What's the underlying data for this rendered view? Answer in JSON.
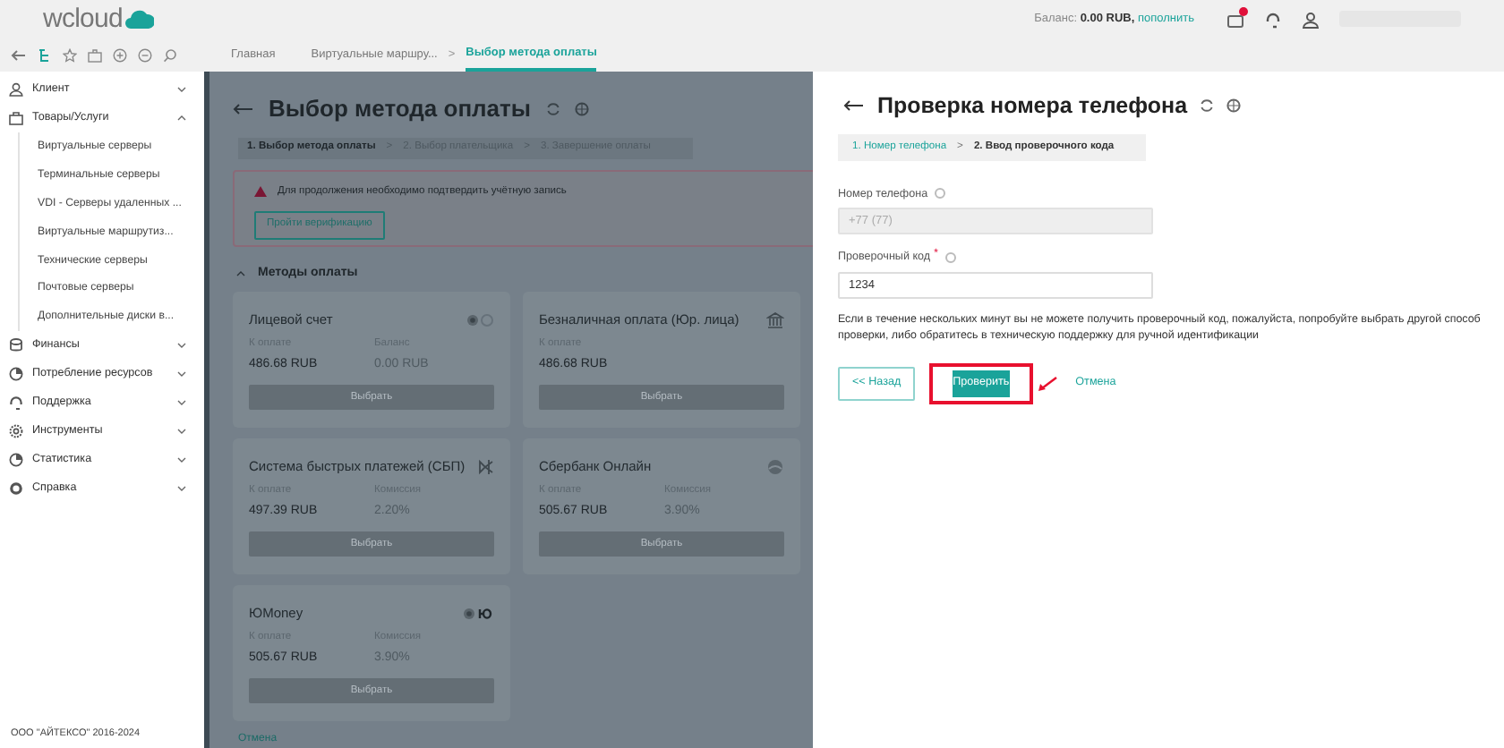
{
  "header": {
    "logo": "wcloud",
    "breadcrumbs": [
      {
        "label": "Главная",
        "selected": false
      },
      {
        "label": "Виртуальные маршру...",
        "selected": false
      },
      {
        "label": "Выбор метода оплаты",
        "selected": true,
        "separator": ">"
      }
    ],
    "balance_label": "Баланс:",
    "balance_amount": "0.00 RUB,",
    "balance_link": "пополнить",
    "notification": true
  },
  "sidebar": {
    "items": [
      {
        "label": "Клиент",
        "expanded": false
      },
      {
        "label": "Товары/Услуги",
        "expanded": true,
        "children": [
          "Виртуальные серверы",
          "Терминальные серверы",
          "VDI - Серверы удаленных ...",
          "Виртуальные маршрутиз...",
          "Технические серверы",
          "Почтовые серверы",
          "Дополнительные диски в..."
        ]
      },
      {
        "label": "Финансы",
        "expanded": false
      },
      {
        "label": "Потребление ресурсов",
        "expanded": false
      },
      {
        "label": "Поддержка",
        "expanded": false
      },
      {
        "label": "Инструменты",
        "expanded": false
      },
      {
        "label": "Статистика",
        "expanded": false
      },
      {
        "label": "Справка",
        "expanded": false
      }
    ],
    "footer": "ООО \"АЙТЕКСО\" 2016-2024"
  },
  "page": {
    "title": "Выбор метода оплаты",
    "steps": [
      {
        "label": "1. Выбор метода оплаты",
        "selected": true
      },
      {
        "label": "2. Выбор плательщика",
        "selected": false,
        "separator": ">"
      },
      {
        "label": "3. Завершение оплаты",
        "selected": false,
        "separator": ">"
      }
    ],
    "alert": {
      "text": "Для продолжения необходимо подтвердить учётную запись",
      "button": "Пройти верификацию"
    },
    "section": {
      "title": "Методы оплаты",
      "expanded": true
    },
    "methods": [
      {
        "name": "Лицевой счет",
        "fields": [
          {
            "label": "К оплате",
            "value": "486.68 RUB"
          },
          {
            "label": "Баланс",
            "value": "0.00 RUB"
          }
        ],
        "button": "Выбрать"
      },
      {
        "name": "Безналичная оплата (Юр. лица)",
        "fields": [
          {
            "label": "К оплате",
            "value": "486.68 RUB"
          }
        ],
        "button": "Выбрать"
      },
      {
        "name": "Система быстрых платежей (СБП)",
        "fields": [
          {
            "label": "К оплате",
            "value": "497.39 RUB"
          },
          {
            "label": "Комиссия",
            "value": "2.20%"
          }
        ],
        "button": "Выбрать"
      },
      {
        "name": "Сбербанк Онлайн",
        "fields": [
          {
            "label": "К оплате",
            "value": "505.67 RUB"
          },
          {
            "label": "Комиссия",
            "value": "3.90%"
          }
        ],
        "button": "Выбрать"
      },
      {
        "name": "ЮMoney",
        "fields": [
          {
            "label": "К оплате",
            "value": "505.67 RUB"
          },
          {
            "label": "Комиссия",
            "value": "3.90%"
          }
        ],
        "button": "Выбрать"
      }
    ],
    "cancel": "Отмена"
  },
  "dialog": {
    "title": "Проверка номера телефона",
    "steps": [
      {
        "label": "1. Номер телефона",
        "selected": false
      },
      {
        "label": "2. Ввод проверочного кода",
        "selected": true,
        "separator": ">"
      }
    ],
    "fields": [
      {
        "label": "Номер телефона",
        "value": "+77 (77)",
        "disabled": true
      },
      {
        "label": "Проверочный код",
        "required_mark": "*",
        "value": "1234",
        "disabled": false
      }
    ],
    "note": "Если в течение нескольких минут вы не можете получить проверочный код, пожалуйста, попробуйте выбрать другой способ проверки, либо обратитесь в техническую поддержку для ручной идентификации",
    "buttons": [
      {
        "label": "<< Назад",
        "kind": "outline",
        "highlighted": false
      },
      {
        "label": "Проверить",
        "kind": "primary",
        "highlighted": true
      },
      {
        "label": "Отмена",
        "kind": "link",
        "highlighted": false
      }
    ]
  }
}
